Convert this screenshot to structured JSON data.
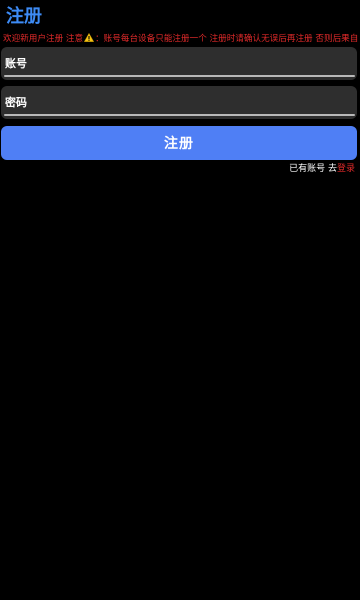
{
  "header": {
    "title": "注册"
  },
  "notice": {
    "prefix": "欢迎新用户注册 注意",
    "icon": "warning-icon",
    "body": "：账号每台设备只能注册一个 注册时请确认无误后再注册 否则后果自负",
    "color": "#e02a2a"
  },
  "form": {
    "account": {
      "label": "账号",
      "value": ""
    },
    "password": {
      "label": "密码",
      "value": ""
    },
    "submit_label": "注册"
  },
  "footer": {
    "prompt": "已有账号 去",
    "login_link": "登录"
  },
  "colors": {
    "background": "#000000",
    "title": "#3d8bf5",
    "field_background": "#2e2e2e",
    "button": "#4f7ff5",
    "notice": "#e02a2a"
  }
}
